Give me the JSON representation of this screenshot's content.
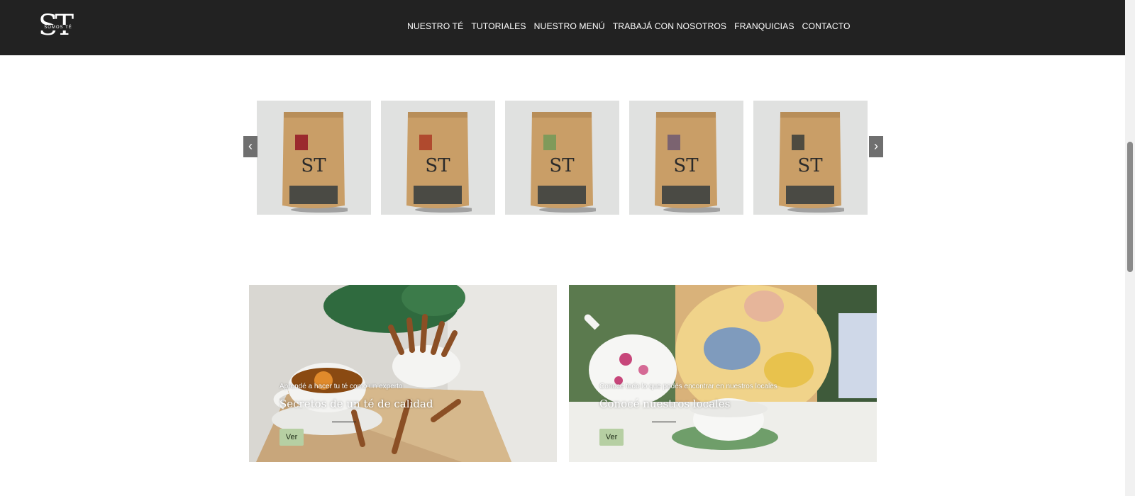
{
  "header": {
    "logo_letters": "ST",
    "logo_band_text": "SOMOS TÉ",
    "nav": [
      "NUESTRO TÉ",
      "TUTORIALES",
      "NUESTRO MENÚ",
      "TRABAJÁ CON NOSOTROS",
      "FRANQUICIAS",
      "CONTACTO"
    ]
  },
  "carousel": {
    "prev_glyph": "‹",
    "next_glyph": "›",
    "products": [
      {
        "label_color": "#9b2a2e",
        "pouch_logo": "ST"
      },
      {
        "label_color": "#b04a2e",
        "pouch_logo": "ST"
      },
      {
        "label_color": "#7f9a5a",
        "pouch_logo": "ST"
      },
      {
        "label_color": "#7b6370",
        "pouch_logo": "ST"
      },
      {
        "label_color": "#4e4b40",
        "pouch_logo": "ST"
      }
    ]
  },
  "features": [
    {
      "subtitle": "Aprendé a hacer tu té como un experto",
      "title": "Secretos de un té de calidad",
      "button": "Ver"
    },
    {
      "subtitle": "Conocé todo lo que podés encontrar en nuestros locales",
      "title": "Conocé nuestros locales",
      "button": "Ver"
    }
  ],
  "colors": {
    "header_bg": "#222222",
    "accent_button": "#b6cfa3",
    "product_bg": "#e0e1e0",
    "pouch_kraft": "#c99e67"
  }
}
